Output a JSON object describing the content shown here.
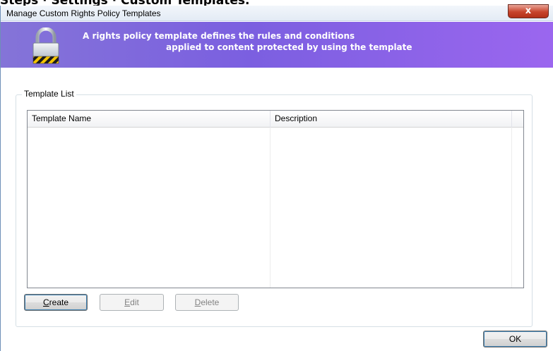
{
  "doc_heading": "Steps · Settings · Custom Templates.",
  "window": {
    "title": "Manage Custom Rights Policy Templates",
    "close_glyph": "x"
  },
  "banner": {
    "line1": "A rights policy template defines the rules and conditions",
    "line2": "applied to content protected by using the template",
    "icon": "lock-icon",
    "gradient_colors": [
      "#8474d8",
      "#7b5fe0",
      "#9b66ef"
    ]
  },
  "template_list": {
    "group_label": "Template List",
    "columns": [
      {
        "label": "Template Name"
      },
      {
        "label": "Description"
      }
    ],
    "rows": []
  },
  "buttons": {
    "create": {
      "mnemonic": "C",
      "rest": "reate",
      "enabled": true
    },
    "edit": {
      "mnemonic": "E",
      "rest": "dit",
      "enabled": false
    },
    "delete": {
      "mnemonic": "D",
      "rest": "elete",
      "enabled": false
    },
    "ok": {
      "label": "OK",
      "enabled": true
    }
  }
}
